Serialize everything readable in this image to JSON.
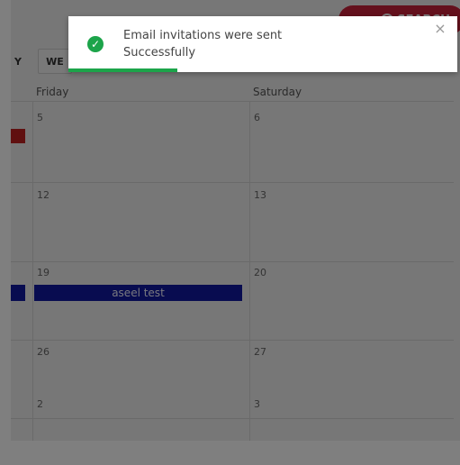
{
  "header": {
    "search_label": "SEARCH",
    "view_tabs": {
      "day_partial": "Y",
      "week_partial": "WE"
    }
  },
  "calendar": {
    "columns": [
      "Friday",
      "Saturday"
    ],
    "weeks": [
      {
        "friday": "5",
        "saturday": "6"
      },
      {
        "friday": "12",
        "saturday": "13"
      },
      {
        "friday": "19",
        "saturday": "20"
      },
      {
        "friday": "26",
        "saturday": "27"
      },
      {
        "friday": "2",
        "saturday": "3"
      }
    ],
    "events": [
      {
        "title": "aseel test",
        "day": "19",
        "color": "#1018a0"
      }
    ]
  },
  "colors": {
    "search_button": "#c9233a",
    "success": "#1ca44a",
    "event_blue": "#1018a0",
    "event_red": "#c02020"
  },
  "toast": {
    "line1": "Email invitations were sent",
    "line2": "Successfully",
    "icon": "check-circle-icon",
    "close_icon": "close-icon",
    "progress": 0.28
  }
}
